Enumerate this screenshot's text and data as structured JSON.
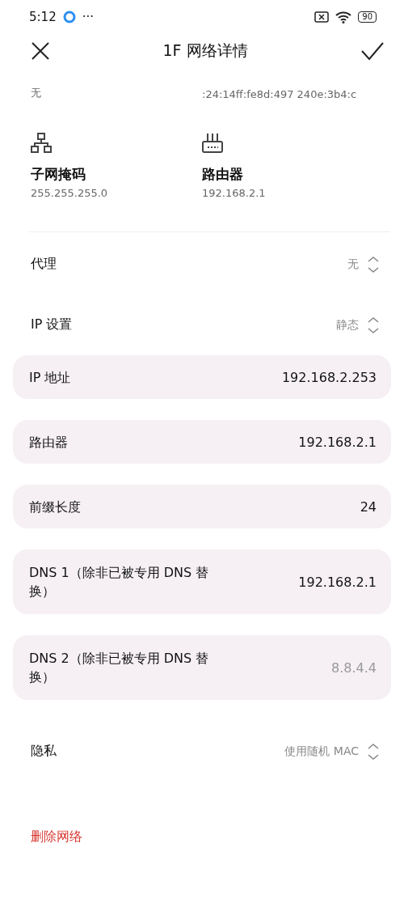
{
  "status_bar": {
    "time": "5:12",
    "more": "···",
    "battery": "90"
  },
  "header": {
    "title": "1F 网络详情"
  },
  "cut_values": [
    "无",
    ":24:14ff:fe8d:497 240e:3b4:c"
  ],
  "info": [
    {
      "kind": "subnet",
      "label": "子网掩码",
      "value": "255.255.255.0"
    },
    {
      "kind": "router",
      "label": "路由器",
      "value": "192.168.2.1"
    }
  ],
  "pickers": [
    {
      "label": "代理",
      "value": "无"
    },
    {
      "label": "IP 设置",
      "value": "静态"
    }
  ],
  "fields": [
    {
      "label": "IP 地址",
      "value": "192.168.2.253"
    },
    {
      "label": "路由器",
      "value": "192.168.2.1"
    },
    {
      "label": "前缀长度",
      "value": "24"
    },
    {
      "label": "DNS 1（除非已被专用 DNS 替换）",
      "value": "192.168.2.1"
    },
    {
      "label": "DNS 2（除非已被专用 DNS 替换）",
      "placeholder": "8.8.4.4"
    }
  ],
  "privacy": {
    "label": "隐私",
    "value": "使用随机 MAC"
  },
  "delete_label": "删除网络"
}
